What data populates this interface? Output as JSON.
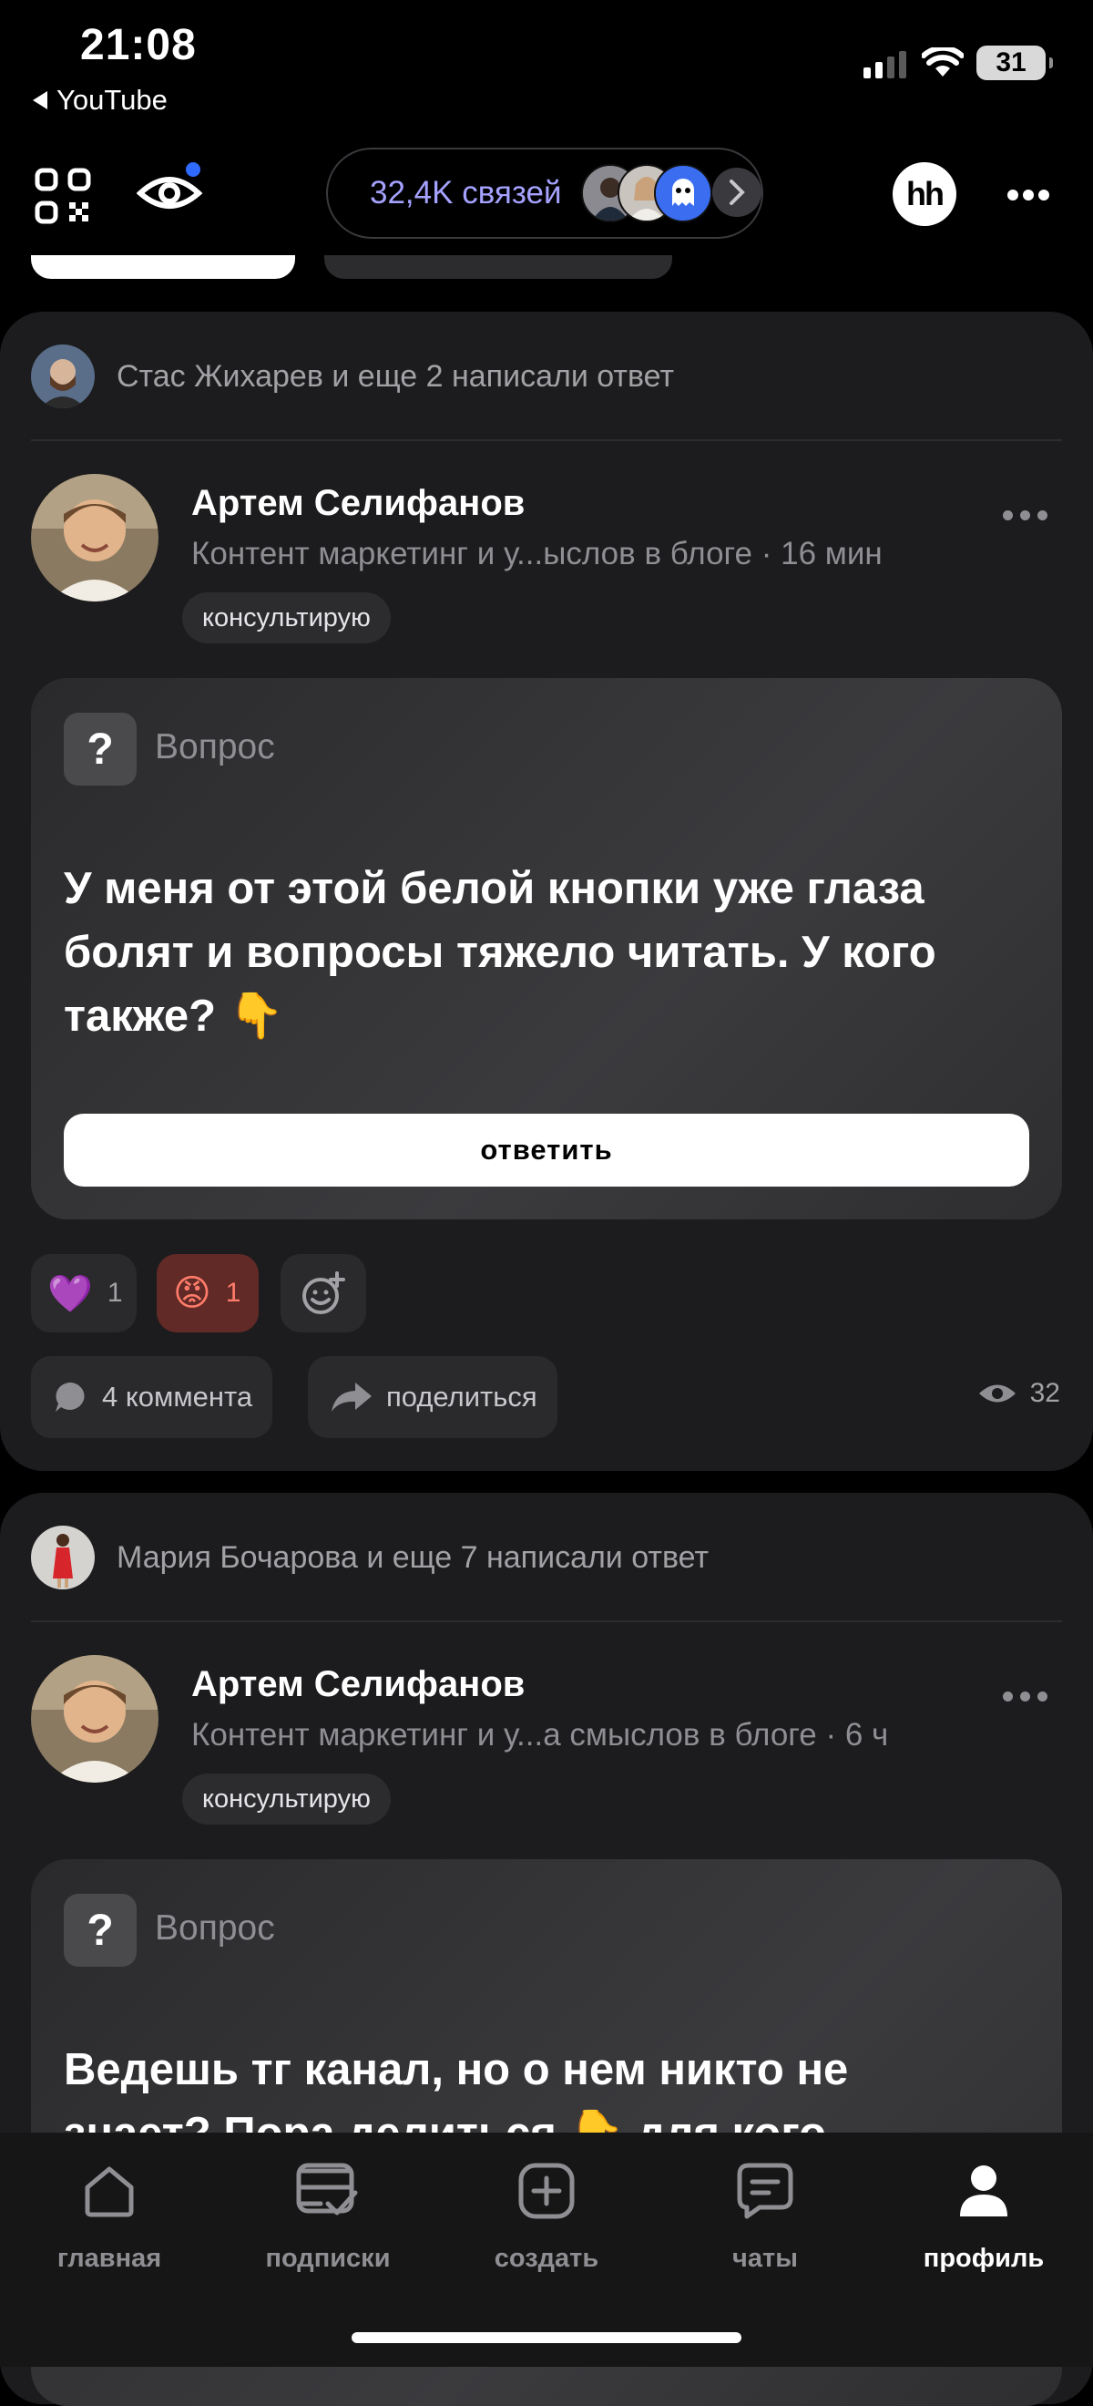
{
  "status_bar": {
    "time": "21:08",
    "back_label": "YouTube",
    "battery": "31"
  },
  "top_bar": {
    "connections": "32,4K связей",
    "hh": "hh"
  },
  "posts": [
    {
      "notification": "Стас Жихарев и еще 2 написали ответ",
      "author": "Артем Селифанов",
      "subtitle": "Контент маркетинг и у...ыслов в блоге · 16 мин",
      "tag": "консультирую",
      "question_label": "Вопрос",
      "question_lines": [
        "У меня от этой белой кнопки уже глаза",
        "болят и вопросы тяжело читать. У кого",
        "также? 👇"
      ],
      "answer_button": "ответить",
      "reactions": [
        {
          "emoji": "💜",
          "count": "1"
        },
        {
          "emoji": "😡",
          "count": "1"
        }
      ],
      "comments": "4 коммента",
      "share": "поделиться",
      "views": "32"
    },
    {
      "notification": "Мария Бочарова и еще 7 написали ответ",
      "author": "Артем Селифанов",
      "subtitle": "Контент маркетинг и у...а смыслов в блоге · 6 ч",
      "tag": "консультирую",
      "question_label": "Вопрос",
      "question_lines": [
        "Ведешь тг канал, но о нем никто не",
        "знает? Пора делиться 👇 для кого"
      ]
    }
  ],
  "bottom_nav": [
    {
      "label": "главная",
      "icon": "home-icon"
    },
    {
      "label": "подписки",
      "icon": "subscriptions-icon"
    },
    {
      "label": "создать",
      "icon": "create-icon"
    },
    {
      "label": "чаты",
      "icon": "chats-icon"
    },
    {
      "label": "профиль",
      "icon": "profile-icon"
    }
  ],
  "colors": {
    "accent": "#a5a2ff",
    "background": "#000000",
    "card": "#1c1c1e",
    "angry_reaction_bg": "#612a26"
  }
}
